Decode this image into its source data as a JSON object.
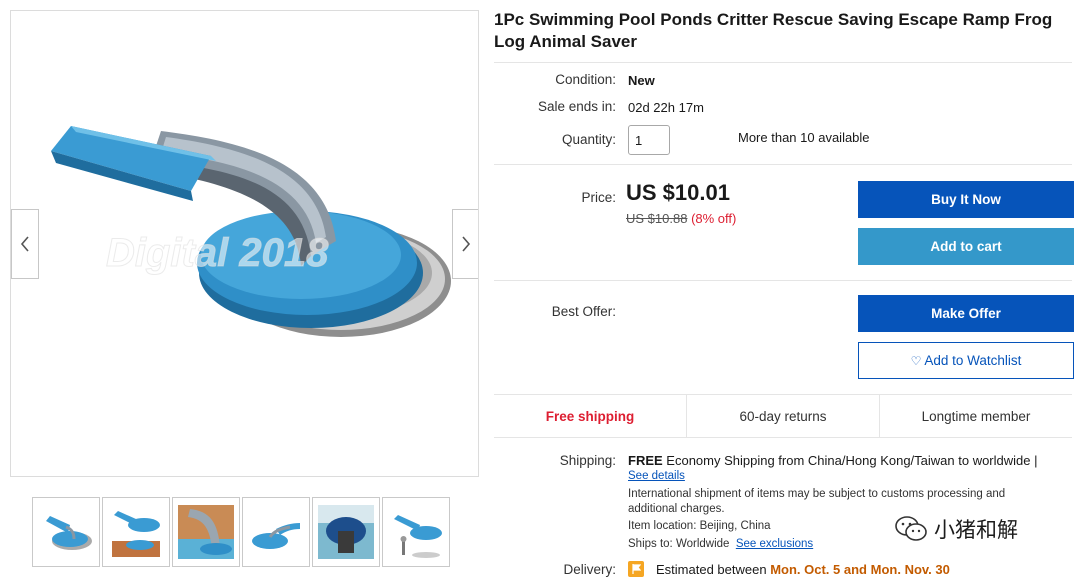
{
  "product": {
    "title": "1Pc Swimming Pool Ponds Critter Rescue Saving Escape Ramp Frog Log Animal Saver",
    "image_watermark": "Digital 2018"
  },
  "gallery": {
    "prev_icon": "chevron-left-icon",
    "next_icon": "chevron-right-icon",
    "thumbnail_count": 6
  },
  "details": {
    "condition_label": "Condition:",
    "condition_value": "New",
    "sale_ends_label": "Sale ends in:",
    "sale_ends_value": "02d 22h 17m",
    "quantity_label": "Quantity:",
    "quantity_value": "1",
    "availability": "More than 10 available"
  },
  "pricing": {
    "price_label": "Price:",
    "price": "US $10.01",
    "was_price": "US $10.88",
    "discount": "(8% off)"
  },
  "actions": {
    "buy_now": "Buy It Now",
    "add_to_cart": "Add to cart",
    "best_offer_label": "Best Offer:",
    "make_offer": "Make Offer",
    "watchlist": "Add to Watchlist"
  },
  "features": [
    "Free shipping",
    "60-day returns",
    "Longtime member"
  ],
  "shipping": {
    "label": "Shipping:",
    "free": "FREE",
    "method": "Economy Shipping from China/Hong Kong/Taiwan to worldwide |",
    "see_details": "See details",
    "notice_line1": "International shipment of items may be subject to customs processing and",
    "notice_line2": "additional charges.",
    "location_label": "Item location:",
    "location_value": "Beijing, China",
    "ships_to_label": "Ships to:",
    "ships_to_value": "Worldwide",
    "see_exclusions": "See exclusions"
  },
  "delivery": {
    "label": "Delivery:",
    "estimated": "Estimated between",
    "start": "Mon. Oct. 5",
    "and": "and",
    "end": "Mon. Nov. 30"
  },
  "watermark": {
    "text": "小猪和解",
    "icon": "wechat-icon"
  },
  "colors": {
    "primary_blue": "#0654ba",
    "cart_blue": "#3498ca",
    "accent_red": "#dd1e31",
    "delivery_orange": "#c35b00"
  }
}
